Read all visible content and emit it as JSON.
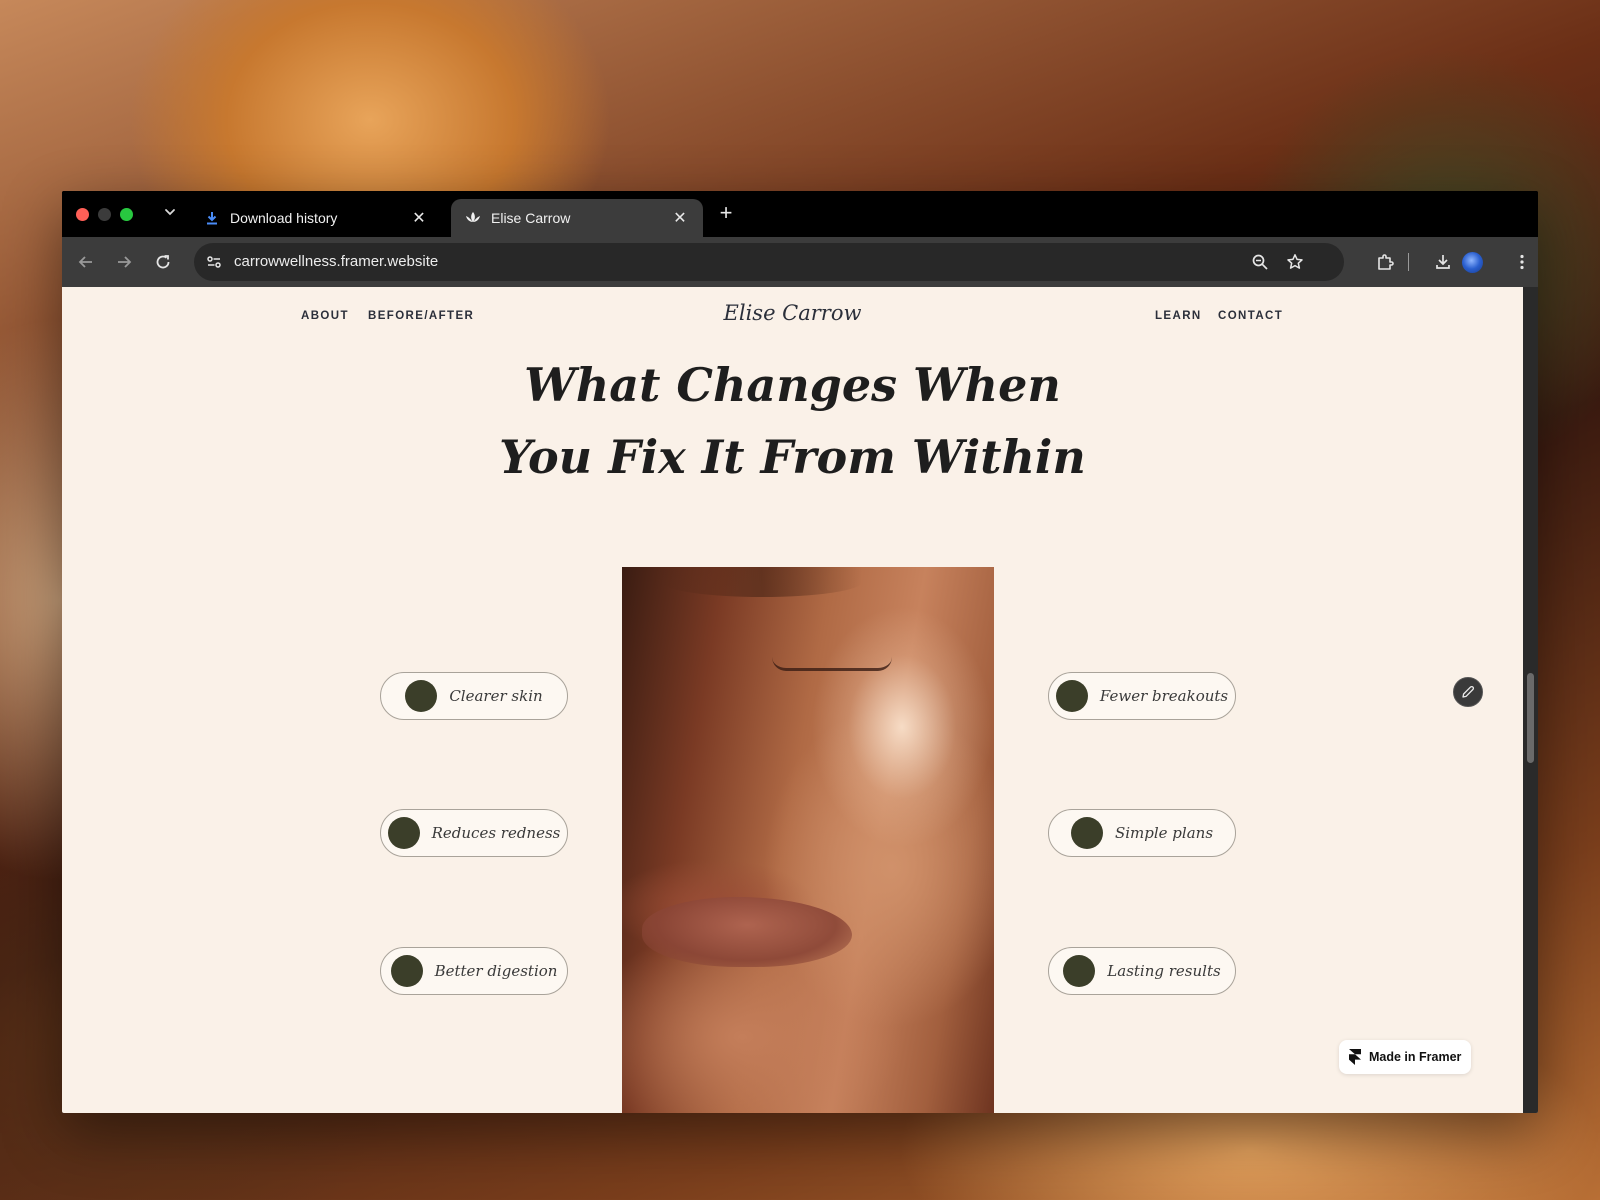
{
  "browser": {
    "tabs": [
      {
        "title": "Download history",
        "icon": "download-icon",
        "active": false
      },
      {
        "title": "Elise Carrow",
        "icon": "lotus-icon",
        "active": true
      }
    ],
    "url": "carrowwellness.framer.website",
    "close_glyph": "✕",
    "new_tab_glyph": "+",
    "tab_menu_glyph": "⌄"
  },
  "site": {
    "brand": "Elise Carrow",
    "nav_left": [
      "ABOUT",
      "BEFORE/AFTER"
    ],
    "nav_right": [
      "LEARN",
      "CONTACT"
    ],
    "headline_line1": "What Changes When",
    "headline_line2": "You Fix It From Within",
    "benefits_left": [
      "Clearer skin",
      "Reduces redness",
      "Better digestion"
    ],
    "benefits_right": [
      "Fewer breakouts",
      "Simple plans",
      "Lasting results"
    ],
    "badge": "Made in Framer",
    "accent_color": "#3b3e29",
    "background_color": "#faf1e8"
  }
}
